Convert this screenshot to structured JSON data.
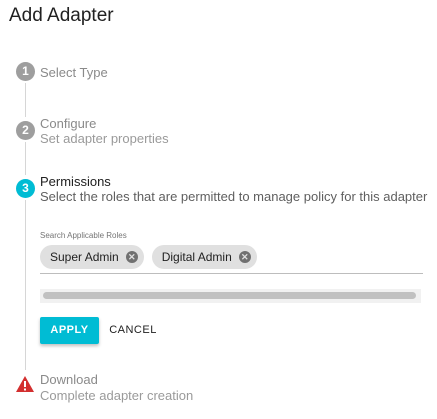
{
  "page": {
    "title": "Add Adapter"
  },
  "steps": [
    {
      "number": "1",
      "title": "Select Type",
      "subtitle": ""
    },
    {
      "number": "2",
      "title": "Configure",
      "subtitle": "Set adapter properties"
    },
    {
      "number": "3",
      "title": "Permissions",
      "subtitle": "Select the roles that are permitted to manage policy for this adapter"
    },
    {
      "number": "",
      "title": "Download",
      "subtitle": "Complete adapter creation",
      "icon": "warning-icon"
    }
  ],
  "roles": {
    "label": "Search Applicable Roles",
    "chips": [
      {
        "label": "Super Admin",
        "remove_icon": "close-circle-icon"
      },
      {
        "label": "Digital Admin",
        "remove_icon": "close-circle-icon"
      }
    ]
  },
  "actions": {
    "apply": "APPLY",
    "cancel": "CANCEL"
  },
  "colors": {
    "accent": "#00bcd4",
    "inactive_step": "#9e9e9e",
    "warning": "#d32f2f",
    "chip_bg": "#e0e0e0"
  }
}
